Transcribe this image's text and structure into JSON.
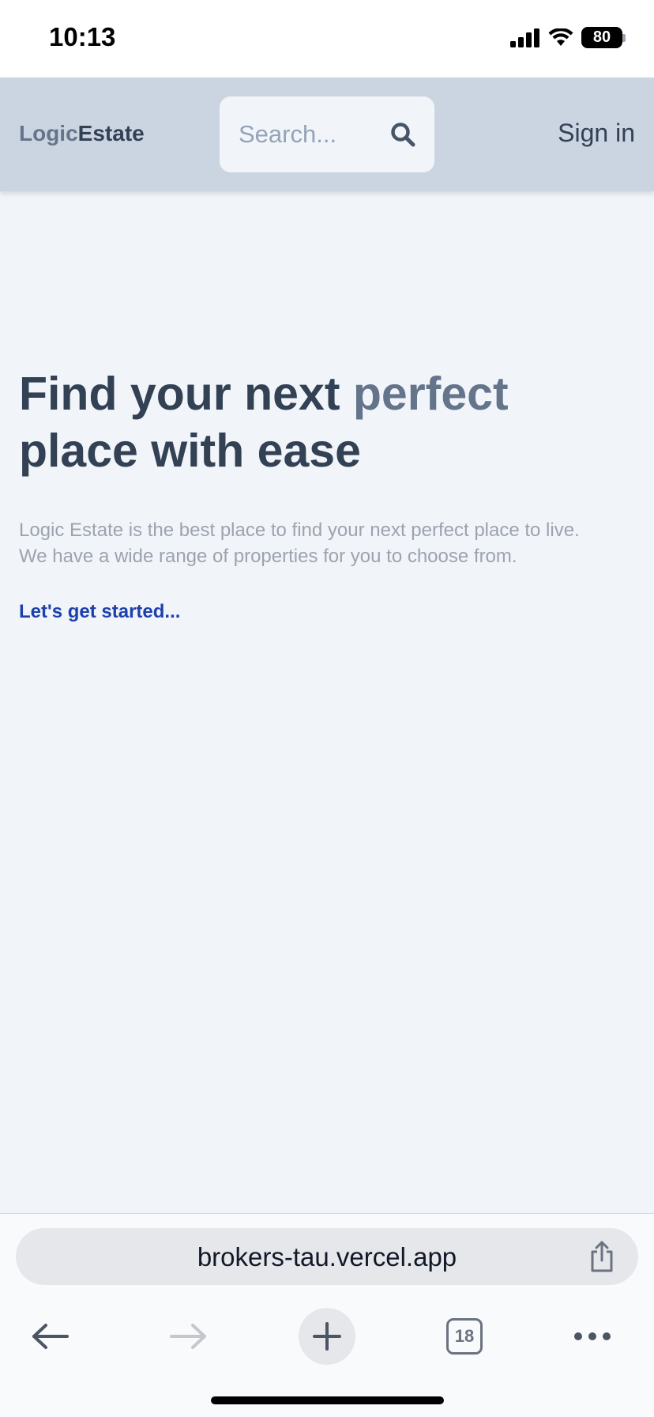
{
  "status_bar": {
    "time": "10:13",
    "battery": "80"
  },
  "header": {
    "logo_part1": "Logic",
    "logo_part2": "Estate",
    "search_placeholder": "Search...",
    "signin_label": "Sign in"
  },
  "hero": {
    "title_part1": "Find your next ",
    "title_accent": "perfect",
    "title_part2": "place with ease",
    "description_line1": "Logic Estate is the best place to find your next perfect place to live.",
    "description_line2": "We have a wide range of properties for you to choose from.",
    "cta_label": "Let's get started..."
  },
  "browser": {
    "url": "brokers-tau.vercel.app",
    "tabs_count": "18"
  },
  "colors": {
    "header_bg": "#cbd5e1",
    "page_bg": "#f1f5f9",
    "title": "#334155",
    "accent": "#64748b",
    "link": "#1e40af"
  },
  "icons": [
    "signal-icon",
    "wifi-icon",
    "battery-icon",
    "search-icon",
    "share-icon",
    "back-arrow-icon",
    "forward-arrow-icon",
    "plus-icon",
    "tabs-icon",
    "more-icon"
  ]
}
